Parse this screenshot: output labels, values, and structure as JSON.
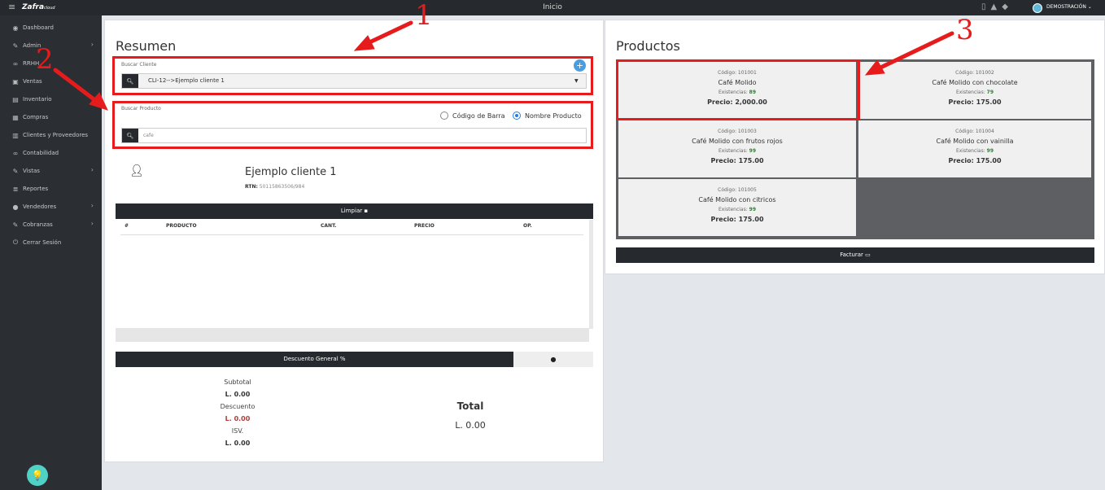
{
  "app": {
    "logo": "Zafra",
    "logo_suffix": "cloud",
    "page_title": "Inicio",
    "user": "DEMOSTRACIÓN ⌄"
  },
  "sidebar": {
    "items": [
      {
        "label": "Dashboard",
        "icon": "dashboard-icon",
        "chevron": false
      },
      {
        "label": "Admin",
        "icon": "wrench-icon",
        "chevron": true
      },
      {
        "label": "RRHH",
        "icon": "link-icon",
        "chevron": false
      },
      {
        "label": "Ventas",
        "icon": "video-icon",
        "chevron": false
      },
      {
        "label": "Inventario",
        "icon": "box-icon",
        "chevron": false
      },
      {
        "label": "Compras",
        "icon": "cart-icon",
        "chevron": false
      },
      {
        "label": "Clientes y Proveedores",
        "icon": "book-icon",
        "chevron": false
      },
      {
        "label": "Contabilidad",
        "icon": "link-icon",
        "chevron": false
      },
      {
        "label": "Vistas",
        "icon": "edit-icon",
        "chevron": true
      },
      {
        "label": "Reportes",
        "icon": "list-icon",
        "chevron": false
      },
      {
        "label": "Vendedores",
        "icon": "user-icon",
        "chevron": true
      },
      {
        "label": "Cobranzas",
        "icon": "edit-icon",
        "chevron": true
      },
      {
        "label": "Cerrar Sesión",
        "icon": "power-icon",
        "chevron": false
      }
    ]
  },
  "summary": {
    "title": "Resumen",
    "client_label": "Buscar Cliente",
    "client_value": "CLI-12-->Ejemplo cliente 1",
    "product_label": "Buscar Producto",
    "radio_barcode": "Código de Barra",
    "radio_name": "Nombre Producto",
    "product_input_value": "cafe",
    "client_name": "Ejemplo cliente 1",
    "rtn_label": "RTN:",
    "rtn_value": "50115863506/984",
    "clear_button": "Limpiar",
    "columns": [
      "#",
      "PRODUCTO",
      "CANT.",
      "PRECIO",
      "OP."
    ],
    "discount_button": "Descuento General",
    "subtotal_label": "Subtotal",
    "subtotal_value": "L. 0.00",
    "discount_label": "Descuento",
    "discount_value": "L. 0.00",
    "isv_label": "ISV.",
    "isv_value": "L. 0.00",
    "total_label": "Total",
    "total_value": "L. 0.00"
  },
  "products": {
    "title": "Productos",
    "stock_label": "Existencias:",
    "items": [
      {
        "code": "Código: 101001",
        "name": "Café Molido",
        "stock": "89",
        "price": "Precio: 2,000.00"
      },
      {
        "code": "Código: 101002",
        "name": "Café Molido con chocolate",
        "stock": "79",
        "price": "Precio: 175.00"
      },
      {
        "code": "Código: 101003",
        "name": "Café Molido con frutos rojos",
        "stock": "99",
        "price": "Precio: 175.00"
      },
      {
        "code": "Código: 101004",
        "name": "Café Molido con vainilla",
        "stock": "99",
        "price": "Precio: 175.00"
      },
      {
        "code": "Código: 101005",
        "name": "Café Molido con citricos",
        "stock": "99",
        "price": "Precio: 175.00"
      }
    ],
    "invoice_button": "Facturar"
  },
  "annotations": {
    "n1": "1",
    "n2": "2",
    "n3": "3"
  },
  "colors": {
    "annotation": "#e61c1c",
    "dark": "#26292e",
    "stock_green": "#2f7d32",
    "discount_red": "#b03a3a",
    "accent_blue": "#2a7be4"
  }
}
